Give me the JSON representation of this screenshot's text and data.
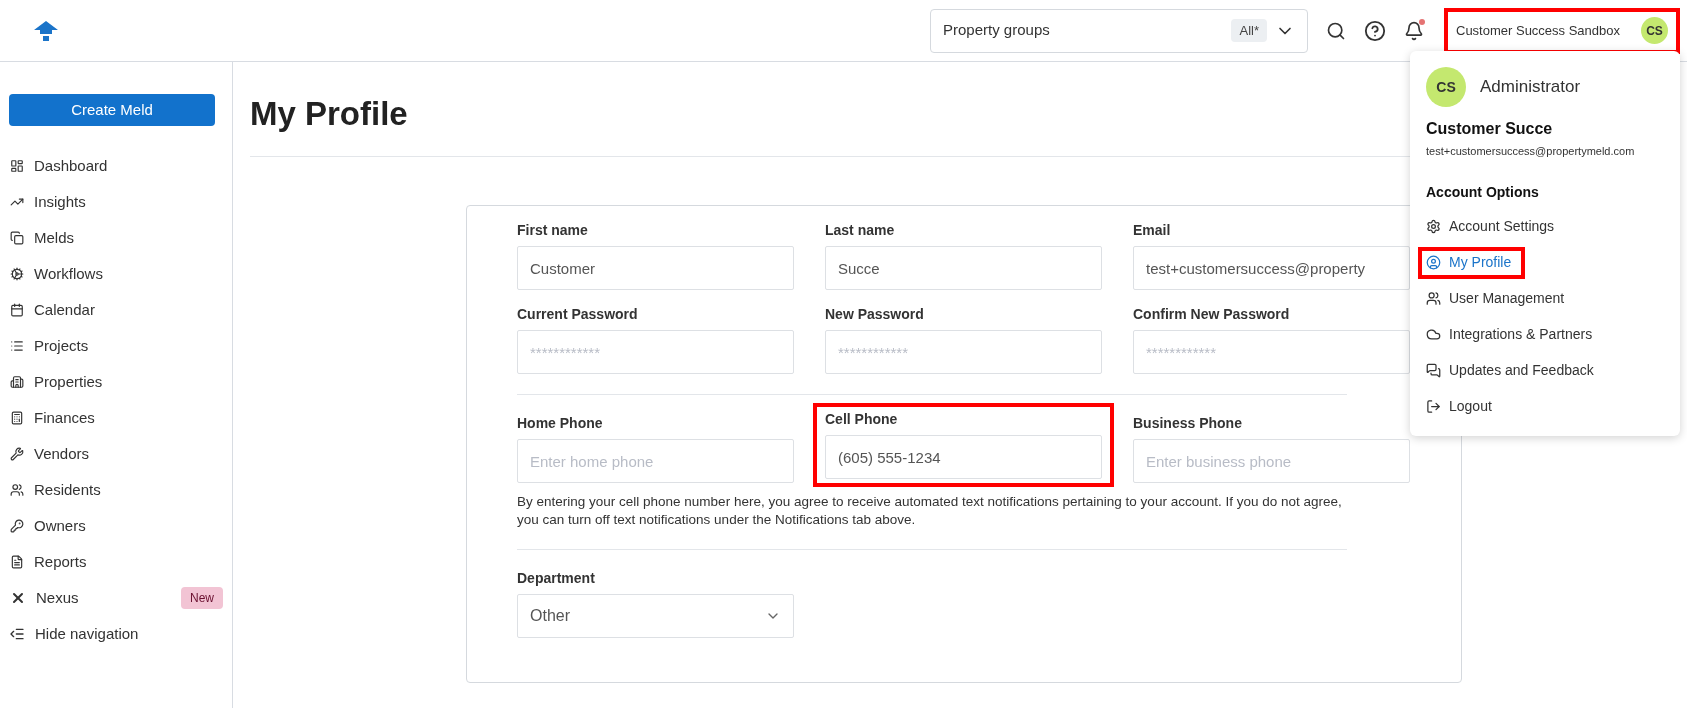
{
  "header": {
    "property_groups": {
      "label": "Property groups",
      "badge": "All*"
    },
    "notifications": {
      "unread": true
    },
    "account_button": {
      "label": "Customer Success Sandbox",
      "initials": "CS",
      "highlighted": true
    }
  },
  "sidebar": {
    "create_button": "Create Meld",
    "items": [
      {
        "label": "Dashboard"
      },
      {
        "label": "Insights"
      },
      {
        "label": "Melds"
      },
      {
        "label": "Workflows"
      },
      {
        "label": "Calendar"
      },
      {
        "label": "Projects"
      },
      {
        "label": "Properties"
      },
      {
        "label": "Finances"
      },
      {
        "label": "Vendors"
      },
      {
        "label": "Residents"
      },
      {
        "label": "Owners"
      },
      {
        "label": "Reports"
      },
      {
        "label": "Nexus",
        "badge": "New"
      }
    ],
    "hide_navigation": "Hide navigation"
  },
  "page": {
    "title": "My Profile"
  },
  "form": {
    "rows": [
      {
        "fields": [
          {
            "kind": "text",
            "label": "First name",
            "value": "Customer",
            "highlighted": false
          },
          {
            "kind": "text",
            "label": "Last name",
            "value": "Succe",
            "highlighted": false
          },
          {
            "kind": "text",
            "label": "Email",
            "value": "test+customersuccess@property",
            "highlighted": false
          }
        ]
      },
      {
        "fields": [
          {
            "kind": "text",
            "label": "Current Password",
            "placeholder": "************",
            "highlighted": false
          },
          {
            "kind": "text",
            "label": "New Password",
            "placeholder": "************",
            "highlighted": false
          },
          {
            "kind": "text",
            "label": "Confirm New Password",
            "placeholder": "************",
            "highlighted": false
          }
        ]
      },
      {
        "fields": [
          {
            "kind": "text",
            "label": "Home Phone",
            "placeholder": "Enter home phone",
            "highlighted": false
          },
          {
            "kind": "text",
            "label": "Cell Phone",
            "value": "(605) 555-1234",
            "highlighted": true
          },
          {
            "kind": "text",
            "label": "Business Phone",
            "placeholder": "Enter business phone",
            "highlighted": false
          }
        ],
        "note": "By entering your cell phone number here, you agree to receive automated text notifications pertaining to your account. If you do not agree, you can turn off text notifications under the Notifications tab above."
      },
      {
        "fields": [
          {
            "kind": "select",
            "label": "Department",
            "value": "Other",
            "highlighted": false
          }
        ]
      }
    ]
  },
  "account_menu": {
    "initials": "CS",
    "role": "Administrator",
    "name": "Customer Succe",
    "email": "test+customersuccess@propertymeld.com",
    "section_title": "Account Options",
    "items": [
      {
        "label": "Account Settings",
        "selected": false,
        "highlighted": false
      },
      {
        "label": "My Profile",
        "selected": true,
        "highlighted": true
      },
      {
        "label": "User Management",
        "selected": false,
        "highlighted": false
      },
      {
        "label": "Integrations & Partners",
        "selected": false,
        "highlighted": false
      },
      {
        "label": "Updates and Feedback",
        "selected": false,
        "highlighted": false
      },
      {
        "label": "Logout",
        "selected": false,
        "highlighted": false
      }
    ]
  }
}
